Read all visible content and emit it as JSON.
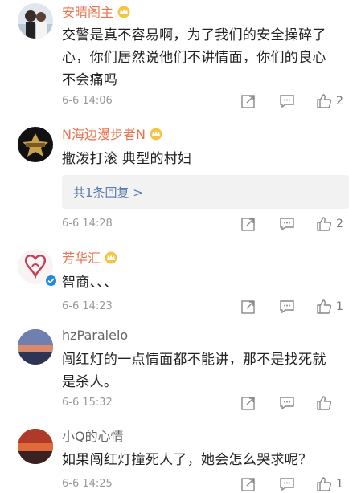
{
  "comments": [
    {
      "username": "安晴阁主",
      "text": "交警是真不容易啊，为了我们的安全操碎了\n心，你们居然说他们不讲情面，你们的良心\n不会痛吗",
      "time": "6-6 14:06",
      "likes": "2"
    },
    {
      "username": "N海边漫步者N",
      "text": "撒泼打滚  典型的村妇",
      "reply_link": "共1条回复 >",
      "time": "6-6 14:28",
      "likes": "2"
    },
    {
      "username": "芳华汇",
      "text": "智商、、、",
      "time": "6-6 14:23",
      "likes": "1"
    },
    {
      "username": "hzParalelo",
      "text": "闯红灯的一点情面都不能讲，那不是找死就\n是杀人。",
      "time": "6-6 15:32",
      "likes": ""
    },
    {
      "username": "小Q的心情",
      "text": "如果闯红灯撞死人了，她会怎么哭求呢？",
      "time": "6-6 14:25",
      "likes": "1"
    }
  ],
  "colors": {
    "vip_name": "#eb7350",
    "link": "#5b7bb3",
    "time": "#999999"
  },
  "icons": [
    "crown-badge-icon",
    "share-icon",
    "comment-icon",
    "thumbs-up-icon",
    "verified-icon"
  ]
}
